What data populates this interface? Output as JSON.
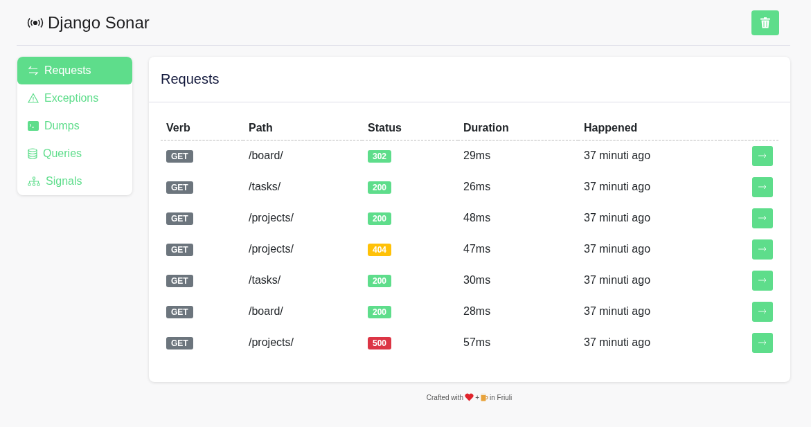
{
  "app": {
    "title": "Django Sonar"
  },
  "sidebar": {
    "items": [
      {
        "label": "Requests",
        "kind": "arrows",
        "selected": true
      },
      {
        "label": "Exceptions",
        "kind": "warning",
        "selected": false
      },
      {
        "label": "Dumps",
        "kind": "terminal",
        "selected": false
      },
      {
        "label": "Queries",
        "kind": "database",
        "selected": false
      },
      {
        "label": "Signals",
        "kind": "tree",
        "selected": false
      }
    ]
  },
  "panel": {
    "title": "Requests"
  },
  "table": {
    "columns": [
      "Verb",
      "Path",
      "Status",
      "Duration",
      "Happened"
    ],
    "rows": [
      {
        "verb": "GET",
        "path": "/board/",
        "status": "302",
        "color": "#5edd8b",
        "duration": "29ms",
        "happened": "37 minuti ago"
      },
      {
        "verb": "GET",
        "path": "/tasks/",
        "status": "200",
        "color": "#5edd8b",
        "duration": "26ms",
        "happened": "37 minuti ago"
      },
      {
        "verb": "GET",
        "path": "/projects/",
        "status": "200",
        "color": "#5edd8b",
        "duration": "48ms",
        "happened": "37 minuti ago"
      },
      {
        "verb": "GET",
        "path": "/projects/",
        "status": "404",
        "color": "#ffc107",
        "duration": "47ms",
        "happened": "37 minuti ago"
      },
      {
        "verb": "GET",
        "path": "/tasks/",
        "status": "200",
        "color": "#5edd8b",
        "duration": "30ms",
        "happened": "37 minuti ago"
      },
      {
        "verb": "GET",
        "path": "/board/",
        "status": "200",
        "color": "#5edd8b",
        "duration": "28ms",
        "happened": "37 minuti ago"
      },
      {
        "verb": "GET",
        "path": "/projects/",
        "status": "500",
        "color": "#dc3545",
        "duration": "57ms",
        "happened": "37 minuti ago"
      }
    ]
  },
  "footer": {
    "before": "Crafted with",
    "plus": "+",
    "after": "in Friuli"
  }
}
